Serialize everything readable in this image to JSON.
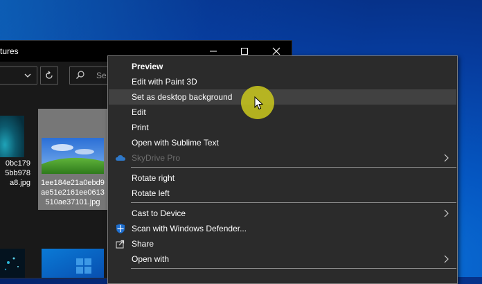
{
  "explorer": {
    "title": "tures",
    "search_placeholder": "Se",
    "files": [
      {
        "caption_lines": [
          "0bc179",
          "5bb978",
          "a8.jpg"
        ]
      },
      {
        "caption_lines": [
          "1ee184e21a0ebd9",
          "ae51e2161ee0613",
          "510ae37101.jpg"
        ]
      }
    ]
  },
  "context_menu": {
    "items": {
      "preview": "Preview",
      "edit_paint3d": "Edit with Paint 3D",
      "set_desktop_bg": "Set as desktop background",
      "edit": "Edit",
      "print": "Print",
      "open_sublime": "Open with Sublime Text",
      "skydrive_pro": "SkyDrive Pro",
      "rotate_right": "Rotate right",
      "rotate_left": "Rotate left",
      "cast_to_device": "Cast to Device",
      "scan_defender": "Scan with Windows Defender...",
      "share": "Share",
      "open_with": "Open with"
    }
  },
  "colors": {
    "menu_bg": "#2b2b2b",
    "menu_hover": "#414141",
    "disabled_text": "#6d6d6d",
    "cursor_highlight": "#c6c41e"
  }
}
